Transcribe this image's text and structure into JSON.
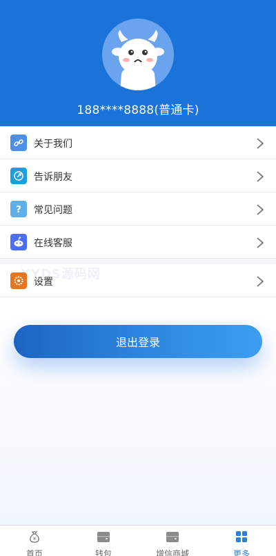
{
  "profile": {
    "phone_label": "188****8888(普通卡)"
  },
  "menu": {
    "items": [
      {
        "label": "关于我们",
        "icon": "link-icon",
        "color": "#4d8fe6"
      },
      {
        "label": "告诉朋友",
        "icon": "share-icon",
        "color": "#1aa0e0"
      },
      {
        "label": "常见问题",
        "icon": "question-icon",
        "color": "#5fb0e8"
      },
      {
        "label": "在线客服",
        "icon": "support-robot-icon",
        "color": "#4c6ef5"
      },
      {
        "label": "设置",
        "icon": "gear-icon",
        "color": "#e8741c"
      }
    ]
  },
  "watermark": "XYDS源码网",
  "actions": {
    "logout_label": "退出登录"
  },
  "tabbar": {
    "tabs": [
      {
        "label": "首页",
        "icon": "money-bag-icon",
        "active": false
      },
      {
        "label": "钱包",
        "icon": "wallet-icon",
        "active": false
      },
      {
        "label": "增信商城",
        "icon": "store-icon",
        "active": false
      },
      {
        "label": "更多",
        "icon": "grid-icon",
        "active": true
      }
    ]
  },
  "colors": {
    "header": "#1a73d9",
    "accent": "#2f7fd6"
  }
}
